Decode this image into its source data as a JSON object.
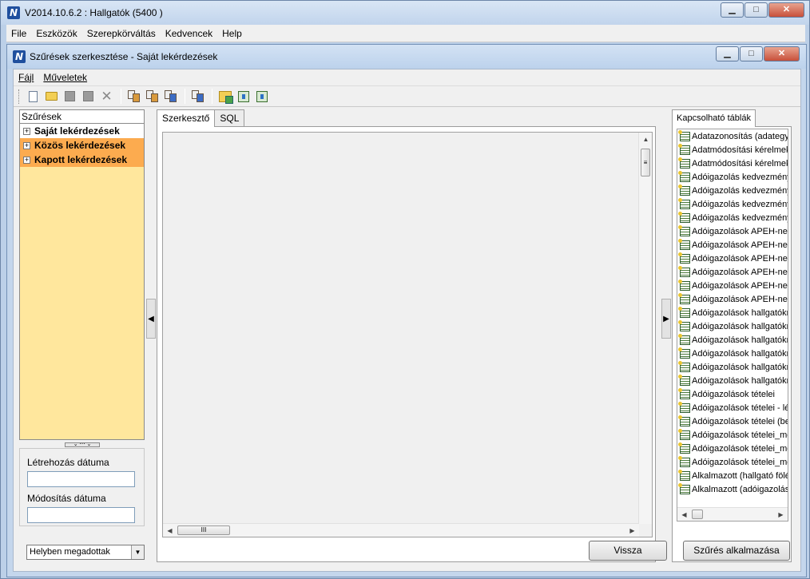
{
  "app": {
    "title": "V2014.10.6.2 : Hallgatók (5400  )",
    "icon": "app-logo-n",
    "menu": [
      "File",
      "Eszközök",
      "Szerepkörváltás",
      "Kedvencek",
      "Help"
    ]
  },
  "dialog": {
    "title": "Szűrések szerkesztése - Saját lekérdezések",
    "menu": [
      "Fájl",
      "Műveletek"
    ]
  },
  "left_panel": {
    "header": "Szűrések",
    "items": [
      {
        "label": "Saját lekérdezések",
        "color": "#ffffff"
      },
      {
        "label": "Közös lekérdezések",
        "color": "#fcab4f"
      },
      {
        "label": "Kapott lekérdezések",
        "color": "#fcab4f"
      }
    ],
    "created_label": "Létrehozás dátuma",
    "created_value": "",
    "modified_label": "Módosítás dátuma",
    "modified_value": ""
  },
  "center": {
    "tabs": [
      "Szerkesztő",
      "SQL"
    ],
    "active_tab": "Szerkesztő"
  },
  "right_panel": {
    "tab": "Kapcsolható táblák",
    "items": [
      "Adatazonosítás (adategyezte",
      "Adatmódosítási kérelmek_el",
      "Adatmódosítási kérelmek_m",
      "Adóigazolás kedvezményeze",
      "Adóigazolás kedvezményeze",
      "Adóigazolás kedvezményeze",
      "Adóigazolás kedvezményeze",
      "Adóigazolások APEH-nek",
      "Adóigazolások APEH-nek - l",
      "Adóigazolások APEH-nek (b",
      "Adóigazolások APEH-nek_m",
      "Adóigazolások APEH-nek_m",
      "Adóigazolások APEH-nek_m",
      "Adóigazolások hallgatóknak",
      "Adóigazolások hallgatóknak",
      "Adóigazolások hallgatóknak",
      "Adóigazolások hallgatóknak",
      "Adóigazolások hallgatóknak",
      "Adóigazolások hallgatóknak",
      "Adóigazolások tételei",
      "Adóigazolások tételei - létreh",
      "Adóigazolások tételei (befize",
      "Adóigazolások tételei_menté",
      "Adóigazolások tételei_menté",
      "Adóigazolások tételei_menté",
      "Alkalmazott  (hallgató fölérer",
      "Alkalmazott  (adóigazolás ked"
    ]
  },
  "bottom": {
    "scope_select": "Helyben megadottak",
    "back_button": "Vissza",
    "apply_button": "Szűrés alkalmazása"
  },
  "colors": {
    "left_panel_bg": "#ffe79d",
    "selected_orange": "#fcab4f",
    "title_bar": "#c1d4ec"
  }
}
